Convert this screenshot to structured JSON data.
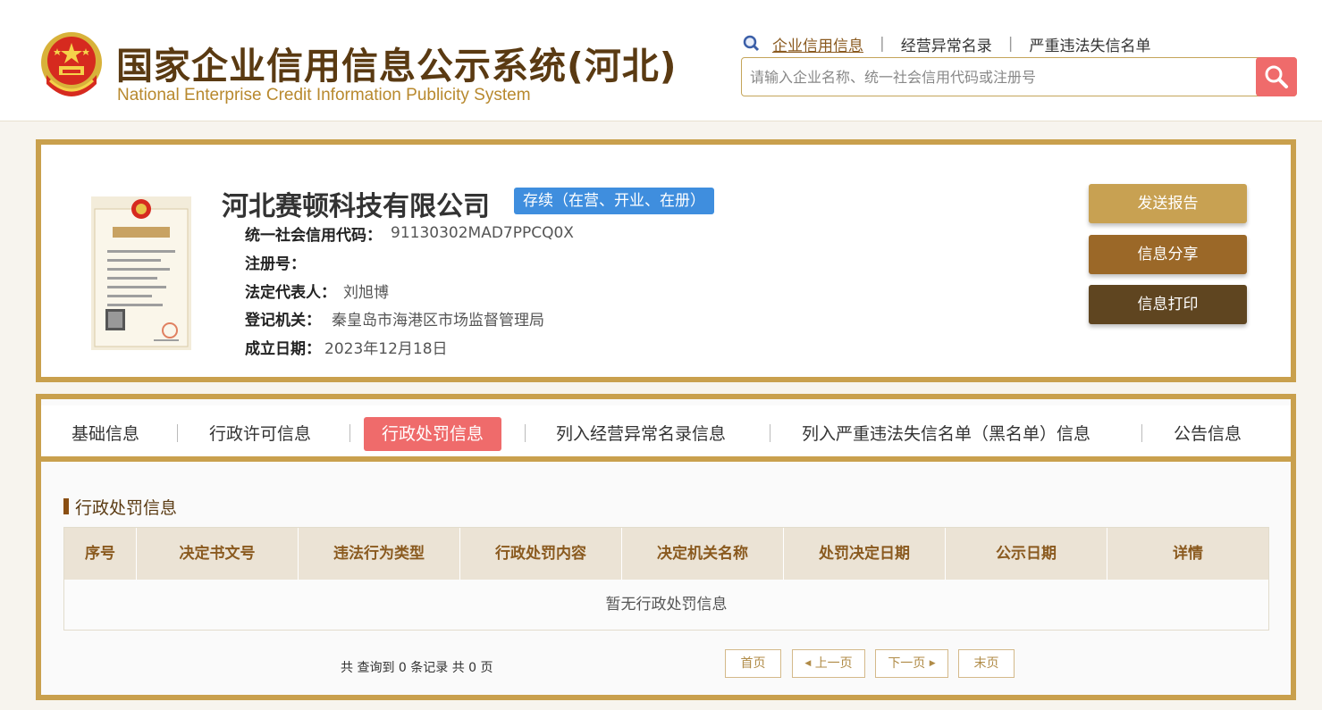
{
  "header": {
    "title_cn": "国家企业信用信息公示系统(河北)",
    "title_en": "National Enterprise Credit Information Publicity System",
    "links": [
      "企业信用信息",
      "经营异常名录",
      "严重违法失信名单"
    ],
    "search_placeholder": "请输入企业名称、统一社会信用代码或注册号"
  },
  "company": {
    "name": "河北赛顿科技有限公司",
    "status": "存续（在营、开业、在册）",
    "credit_code_label": "统一社会信用代码：",
    "credit_code": "91130302MAD7PPCQ0X",
    "reg_no_label": "注册号：",
    "reg_no": "",
    "legal_rep_label": "法定代表人：",
    "legal_rep": "刘旭博",
    "reg_authority_label": "登记机关：",
    "reg_authority": "秦皇岛市海港区市场监督管理局",
    "est_date_label": "成立日期：",
    "est_date": "2023年12月18日",
    "buttons": {
      "report": "发送报告",
      "share": "信息分享",
      "print": "信息打印"
    }
  },
  "tabs": [
    "基础信息",
    "行政许可信息",
    "行政处罚信息",
    "列入经营异常名录信息",
    "列入严重违法失信名单（黑名单）信息",
    "公告信息"
  ],
  "active_tab": "行政处罚信息",
  "section": {
    "title": "行政处罚信息",
    "columns": [
      "序号",
      "决定书文号",
      "违法行为类型",
      "行政处罚内容",
      "决定机关名称",
      "处罚决定日期",
      "公示日期",
      "详情"
    ],
    "empty_text": "暂无行政处罚信息"
  },
  "pagination": {
    "summary": "共 查询到 0 条记录 共 0 页",
    "first": "首页",
    "prev": "上一页",
    "next": "下一页",
    "last": "末页"
  },
  "colors": {
    "gold_border": "#c9a04d",
    "active_tab": "#ef6b6b",
    "status_blue": "#3f8ede"
  }
}
